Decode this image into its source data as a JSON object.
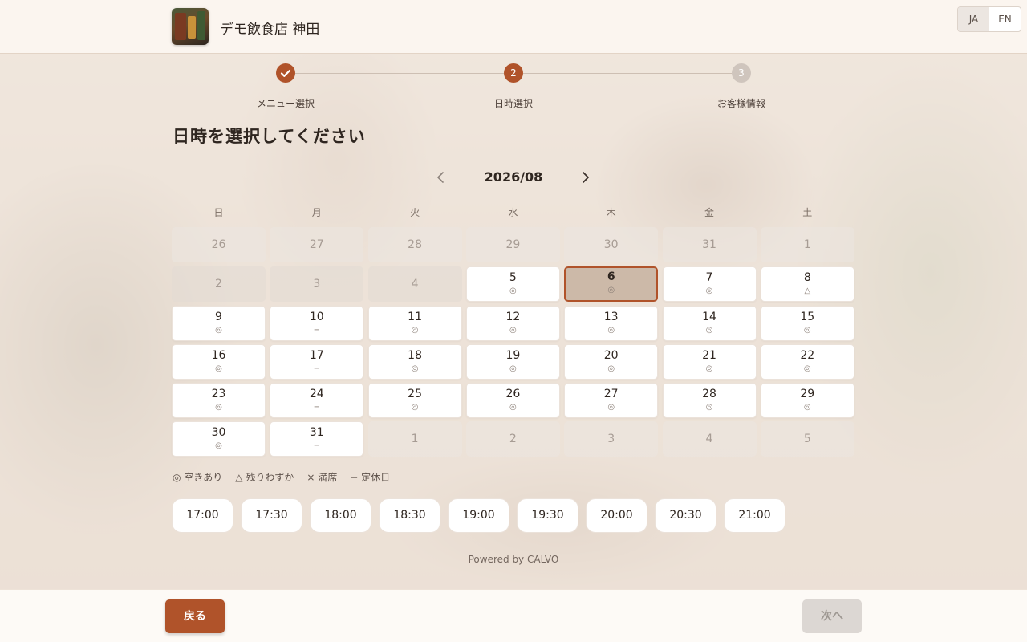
{
  "header": {
    "shop_name": "デモ飲食店 神田",
    "lang": [
      "JA",
      "EN"
    ],
    "active_lang": "JA"
  },
  "steps": [
    {
      "label": "メニュー選択",
      "status": "done",
      "number": ""
    },
    {
      "label": "日時選択",
      "status": "current",
      "number": "2"
    },
    {
      "label": "お客様情報",
      "status": "todo",
      "number": "3"
    }
  ],
  "page_title": "日時を選択してください",
  "calendar": {
    "month": "2026/08",
    "weekdays": [
      "日",
      "月",
      "火",
      "水",
      "木",
      "金",
      "土"
    ],
    "rows": [
      [
        {
          "d": "26",
          "m": "",
          "s": "muted"
        },
        {
          "d": "27",
          "m": "",
          "s": "muted"
        },
        {
          "d": "28",
          "m": "",
          "s": "muted"
        },
        {
          "d": "29",
          "m": "",
          "s": "muted"
        },
        {
          "d": "30",
          "m": "",
          "s": "muted"
        },
        {
          "d": "31",
          "m": "",
          "s": "muted"
        },
        {
          "d": "1",
          "m": "",
          "s": "muted"
        }
      ],
      [
        {
          "d": "2",
          "m": "",
          "s": "past"
        },
        {
          "d": "3",
          "m": "",
          "s": "past"
        },
        {
          "d": "4",
          "m": "",
          "s": "past"
        },
        {
          "d": "5",
          "m": "◎",
          "s": "open"
        },
        {
          "d": "6",
          "m": "◎",
          "s": "selected"
        },
        {
          "d": "7",
          "m": "◎",
          "s": "open"
        },
        {
          "d": "8",
          "m": "△",
          "s": "open"
        }
      ],
      [
        {
          "d": "9",
          "m": "◎",
          "s": "open"
        },
        {
          "d": "10",
          "m": "−",
          "s": "open"
        },
        {
          "d": "11",
          "m": "◎",
          "s": "open"
        },
        {
          "d": "12",
          "m": "◎",
          "s": "open"
        },
        {
          "d": "13",
          "m": "◎",
          "s": "open"
        },
        {
          "d": "14",
          "m": "◎",
          "s": "open"
        },
        {
          "d": "15",
          "m": "◎",
          "s": "open"
        }
      ],
      [
        {
          "d": "16",
          "m": "◎",
          "s": "open"
        },
        {
          "d": "17",
          "m": "−",
          "s": "open"
        },
        {
          "d": "18",
          "m": "◎",
          "s": "open"
        },
        {
          "d": "19",
          "m": "◎",
          "s": "open"
        },
        {
          "d": "20",
          "m": "◎",
          "s": "open"
        },
        {
          "d": "21",
          "m": "◎",
          "s": "open"
        },
        {
          "d": "22",
          "m": "◎",
          "s": "open"
        }
      ],
      [
        {
          "d": "23",
          "m": "◎",
          "s": "open"
        },
        {
          "d": "24",
          "m": "−",
          "s": "open"
        },
        {
          "d": "25",
          "m": "◎",
          "s": "open"
        },
        {
          "d": "26",
          "m": "◎",
          "s": "open"
        },
        {
          "d": "27",
          "m": "◎",
          "s": "open"
        },
        {
          "d": "28",
          "m": "◎",
          "s": "open"
        },
        {
          "d": "29",
          "m": "◎",
          "s": "open"
        }
      ],
      [
        {
          "d": "30",
          "m": "◎",
          "s": "open"
        },
        {
          "d": "31",
          "m": "−",
          "s": "open"
        },
        {
          "d": "1",
          "m": "",
          "s": "muted"
        },
        {
          "d": "2",
          "m": "",
          "s": "muted"
        },
        {
          "d": "3",
          "m": "",
          "s": "muted"
        },
        {
          "d": "4",
          "m": "",
          "s": "muted"
        },
        {
          "d": "5",
          "m": "",
          "s": "muted"
        }
      ]
    ]
  },
  "legend": [
    "◎ 空きあり",
    "△ 残りわずか",
    "× 満席",
    "− 定休日"
  ],
  "times": [
    "17:00",
    "17:30",
    "18:00",
    "18:30",
    "19:00",
    "19:30",
    "20:00",
    "20:30",
    "21:00"
  ],
  "powered_by": "Powered by CALVO",
  "footer": {
    "back_label": "戻る",
    "next_label": "次へ"
  },
  "colors": {
    "accent": "#b0532a",
    "disabled": "#dcd7d3"
  }
}
